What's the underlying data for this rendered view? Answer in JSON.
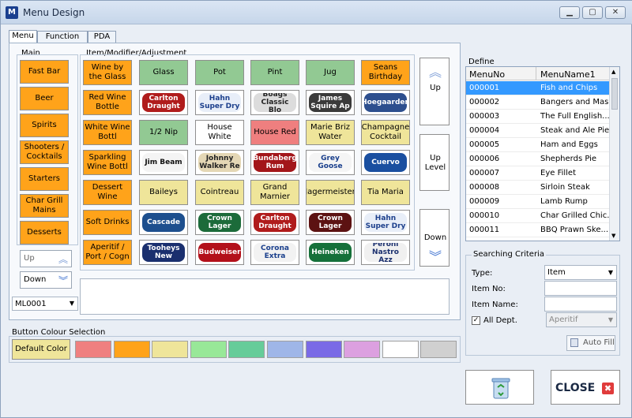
{
  "window": {
    "title": "Menu Design",
    "app_icon_letter": "M"
  },
  "tabs": [
    "Menu",
    "Function List",
    "PDA"
  ],
  "main": {
    "title": "Main",
    "buttons": [
      "Fast Bar",
      "Beer",
      "Spirits",
      "Shooters / Cocktails",
      "Starters",
      "Char Grill Mains",
      "Desserts"
    ],
    "up_label": "Up",
    "down_label": "Down",
    "layout_value": "ML0001"
  },
  "items": {
    "title": "Item/Modifier/Adjustment",
    "rows": [
      [
        {
          "text": "Wine by the Glass",
          "bg": "#ffa31a"
        },
        {
          "text": "Glass",
          "bg": "#92c993"
        },
        {
          "text": "Pot",
          "bg": "#92c993"
        },
        {
          "text": "Pint",
          "bg": "#92c993"
        },
        {
          "text": "Jug",
          "bg": "#92c993"
        },
        {
          "text": "Seans Birthday",
          "bg": "#ffa31a"
        }
      ],
      [
        {
          "text": "Red Wine Bottle",
          "bg": "#ffa31a"
        },
        {
          "logo": "Carlton Draught",
          "fg": "#fff",
          "lbg": "#b01c1c"
        },
        {
          "logo": "Hahn Super Dry",
          "fg": "#1c3f8c",
          "lbg": "#e8eef8"
        },
        {
          "logo": "Boags Classic Blo",
          "fg": "#222",
          "lbg": "#dcdcdc"
        },
        {
          "logo": "James Squire Ap",
          "fg": "#fff",
          "lbg": "#3a3a3a"
        },
        {
          "logo": "Hoegaarden",
          "fg": "#fff",
          "lbg": "#2d4f8e"
        }
      ],
      [
        {
          "text": "White Wine Bottl",
          "bg": "#ffa31a"
        },
        {
          "text": "1/2 Nip",
          "bg": "#92c993"
        },
        {
          "text": "House White",
          "bg": "#ffffff"
        },
        {
          "text": "House Red",
          "bg": "#ef7f7f"
        },
        {
          "text": "Marie Briz Water",
          "bg": "#efe59a"
        },
        {
          "text": "Champagne Cocktail",
          "bg": "#efe59a"
        }
      ],
      [
        {
          "text": "Sparkling Wine Bottl",
          "bg": "#ffa31a"
        },
        {
          "logo": "Jim Beam",
          "fg": "#111",
          "lbg": "#f4f4f4"
        },
        {
          "logo": "Johnny Walker Re",
          "fg": "#222",
          "lbg": "#e4d7b5"
        },
        {
          "logo": "Bundaberg Rum",
          "fg": "#fff",
          "lbg": "#a3161a"
        },
        {
          "logo": "Grey Goose",
          "fg": "#1a3f8c",
          "lbg": "#f5f5f5"
        },
        {
          "logo": "Cuervo",
          "fg": "#fff",
          "lbg": "#1a4fa0"
        }
      ],
      [
        {
          "text": "Dessert Wine",
          "bg": "#ffa31a"
        },
        {
          "text": "Baileys",
          "bg": "#efe59a"
        },
        {
          "text": "Cointreau",
          "bg": "#efe59a"
        },
        {
          "text": "Grand Marnier",
          "bg": "#efe59a"
        },
        {
          "text": "Jagermeister",
          "bg": "#efe59a"
        },
        {
          "text": "Tia Maria",
          "bg": "#efe59a"
        }
      ],
      [
        {
          "text": "Soft Drinks",
          "bg": "#ffa31a"
        },
        {
          "logo": "Cascade",
          "fg": "#fff",
          "lbg": "#1d4f8e"
        },
        {
          "logo": "Crown Lager",
          "fg": "#fff",
          "lbg": "#1c6b3a"
        },
        {
          "logo": "Carlton Draught",
          "fg": "#fff",
          "lbg": "#b01c1c"
        },
        {
          "logo": "Crown Lager",
          "fg": "#fff",
          "lbg": "#5c1212"
        },
        {
          "logo": "Hahn Super Dry",
          "fg": "#1c3f8c",
          "lbg": "#e8eef8"
        }
      ],
      [
        {
          "text": "Aperitif / Port / Cogn",
          "bg": "#ffa31a"
        },
        {
          "logo": "Tooheys New",
          "fg": "#fff",
          "lbg": "#1a2f6e"
        },
        {
          "logo": "Budweiser",
          "fg": "#fff",
          "lbg": "#b3101a"
        },
        {
          "logo": "Corona Extra",
          "fg": "#1a3f8c",
          "lbg": "#f2f2f2"
        },
        {
          "logo": "Heineken",
          "fg": "#fff",
          "lbg": "#15703a"
        },
        {
          "logo": "Peroni Nastro Azz",
          "fg": "#1a2f6e",
          "lbg": "#f0f0f0"
        }
      ]
    ],
    "nav": {
      "up": "Up",
      "up_level": "Up Level",
      "down": "Down"
    }
  },
  "define": {
    "title": "Define",
    "columns": [
      "MenuNo",
      "MenuName1"
    ],
    "rows": [
      [
        "000001",
        "Fish and Chips"
      ],
      [
        "000002",
        "Bangers and Mash"
      ],
      [
        "000003",
        "The Full English..."
      ],
      [
        "000004",
        "Steak and Ale Pie"
      ],
      [
        "000005",
        "Ham and Eggs"
      ],
      [
        "000006",
        "Shepherds Pie"
      ],
      [
        "000007",
        "Eye Fillet"
      ],
      [
        "000008",
        "Sirloin Steak"
      ],
      [
        "000009",
        "Lamb Rump"
      ],
      [
        "000010",
        "Char Grilled Chic..."
      ],
      [
        "000011",
        "BBQ Prawn Ske..."
      ]
    ],
    "selected_index": 0
  },
  "search": {
    "title": "Searching Criteria",
    "type_label": "Type:",
    "type_value": "Item",
    "item_no_label": "Item No:",
    "item_name_label": "Item Name:",
    "all_dept_label": "All Dept.",
    "all_dept_checked": true,
    "dept_value": "Aperitif",
    "auto_fill_label": "Auto Fill"
  },
  "colour": {
    "title": "Button Colour Selection",
    "default_label": "Default Color",
    "swatches": [
      "#ef8080",
      "#ffa31a",
      "#efe59a",
      "#98e898",
      "#66cc99",
      "#9fb6e8",
      "#7a6ae6",
      "#dca0e0",
      "#ffffff",
      "#d0d0d0"
    ]
  },
  "close_label": "CLOSE"
}
